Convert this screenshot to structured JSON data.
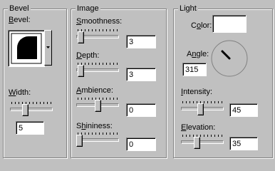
{
  "bevel": {
    "title": "Bevel",
    "bevel_label_u": "B",
    "bevel_label_rest": "evel:",
    "width_label_u": "W",
    "width_label_rest": "idth:",
    "width_value": "5",
    "width_slider_level": 0.33,
    "shape_icon": "quarter-circle-bevel-icon",
    "dropdown_icon": "dropdown-arrow-icon"
  },
  "image": {
    "title": "Image",
    "smoothness_u": "S",
    "smoothness_rest": "moothness:",
    "smoothness_value": "3",
    "smoothness_level": 0.03,
    "depth_u": "D",
    "depth_rest": "epth:",
    "depth_value": "3",
    "depth_level": 0.03,
    "ambience_pre": "",
    "ambience_u": "A",
    "ambience_rest": "mbience:",
    "ambience_value": "0",
    "ambience_level": 0.5,
    "shininess_pre": "S",
    "shininess_u": "h",
    "shininess_rest": "ininess:",
    "shininess_value": "0",
    "shininess_level": 0.0
  },
  "light": {
    "title": "Light",
    "color_pre": "C",
    "color_u": "o",
    "color_rest": "lor:",
    "color_swatch": "#ffffff",
    "angle_pre": "A",
    "angle_u": "n",
    "angle_rest": "gle:",
    "angle_value": "315",
    "angle_dial_icon": "angle-dial-icon",
    "intensity_u": "I",
    "intensity_rest": "ntensity:",
    "intensity_value": "45",
    "intensity_level": 0.45,
    "elevation_u": "E",
    "elevation_rest": "levation:",
    "elevation_value": "35",
    "elevation_level": 0.35
  }
}
